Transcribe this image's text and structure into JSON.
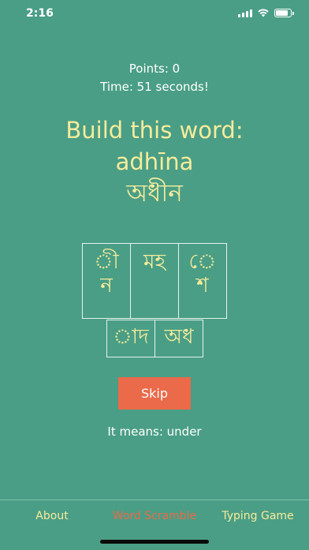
{
  "status_bar": {
    "time": "2:16"
  },
  "game": {
    "points": "Points: 0",
    "timer": "Time: 51 seconds!",
    "prompt": "Build this word:",
    "transliteration": "adhīna",
    "target_word": "অধীন",
    "tiles_row1": [
      "ী\nন",
      "মহ",
      "ে\nশ"
    ],
    "tiles_row2": [
      "াদ",
      "অধ"
    ],
    "skip_label": "Skip",
    "meaning": "It means: under"
  },
  "tabs": {
    "about": "About",
    "word_scramble": "Word Scramble",
    "typing_game": "Typing Game",
    "active_tab": "Word Scramble"
  },
  "colors": {
    "background": "#4a9e85",
    "accent_yellow": "#f6ec9c",
    "skip_button": "#ea6a4a",
    "active_tab": "#ea6a4a"
  }
}
